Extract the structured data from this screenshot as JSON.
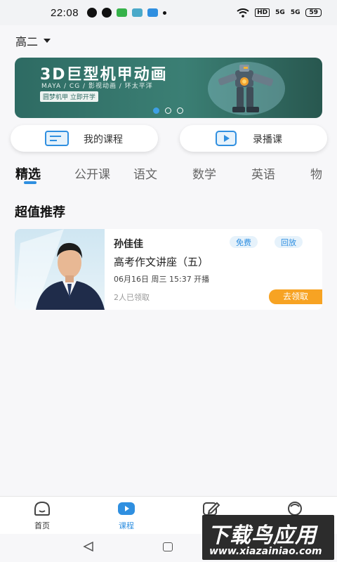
{
  "status_bar": {
    "time": "22:08",
    "battery": "59",
    "signal_1": "5G",
    "signal_2": "5G",
    "hd": "HD"
  },
  "header": {
    "grade": "高二"
  },
  "banner": {
    "title": "3D巨型机甲动画",
    "subtitle": "MAYA / CG / 影视动画 / 环太平洋",
    "tag": "圆梦机甲 立即开学",
    "pagination": {
      "count": 3,
      "active_index": 0
    }
  },
  "quick_actions": [
    {
      "label": "我的课程",
      "icon": "course-list-icon"
    },
    {
      "label": "录播课",
      "icon": "play-video-icon"
    }
  ],
  "tabs": [
    {
      "label": "精选",
      "active": true
    },
    {
      "label": "公开课",
      "active": false
    },
    {
      "label": "语文",
      "active": false
    },
    {
      "label": "数学",
      "active": false
    },
    {
      "label": "英语",
      "active": false
    },
    {
      "label": "物",
      "active": false
    }
  ],
  "section": {
    "title": "超值推荐"
  },
  "course_card": {
    "teacher": "孙佳佳",
    "badges": [
      "免费",
      "回放"
    ],
    "title": "高考作文讲座（五）",
    "schedule": "06月16日 周三 15:37 开播",
    "claimed": "2人已领取",
    "action": "去领取"
  },
  "bottom_nav": [
    {
      "label": "首页",
      "icon": "home-face-icon",
      "active": false
    },
    {
      "label": "课程",
      "icon": "course-play-icon",
      "active": true
    },
    {
      "label": "",
      "icon": "edit-icon",
      "active": false
    },
    {
      "label": "",
      "icon": "profile-icon",
      "active": false
    }
  ],
  "watermark": {
    "line1": "下载鸟应用",
    "line2": "www.xiazainiao.com"
  },
  "colors": {
    "accent": "#2f8fe0",
    "claim": "#f7a323",
    "banner": "#2e6b63"
  }
}
